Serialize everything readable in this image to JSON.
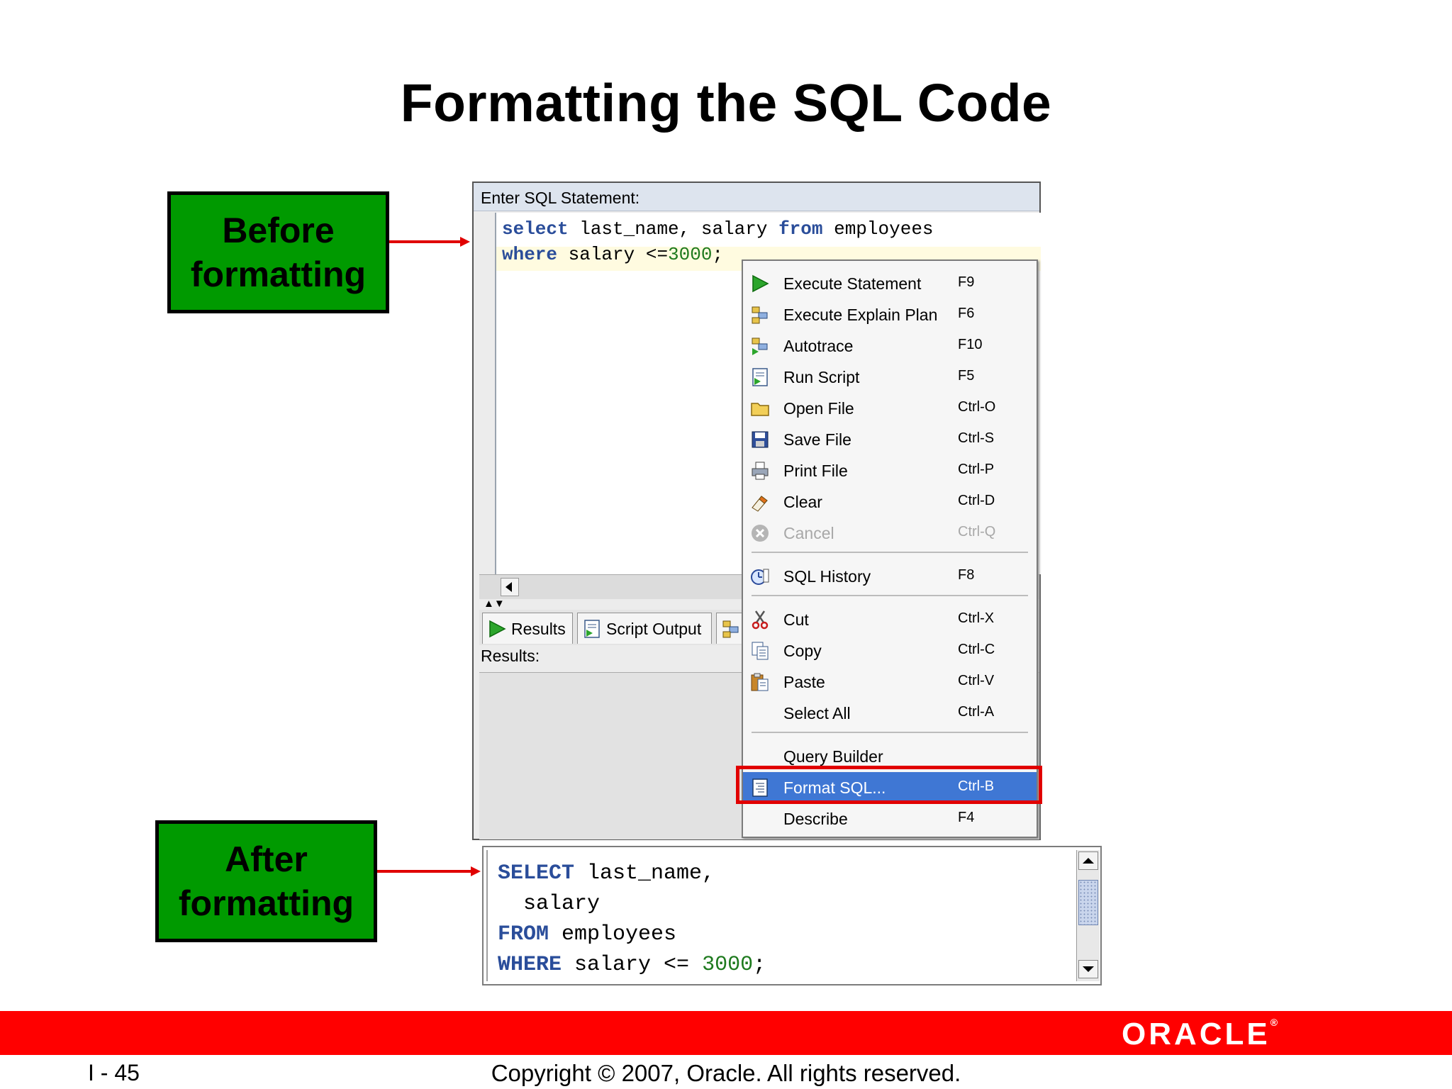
{
  "title": "Formatting the SQL Code",
  "callouts": {
    "before_line1": "Before",
    "before_line2": "formatting",
    "after_line1": "After",
    "after_line2": "formatting"
  },
  "sql_window": {
    "label": "Enter SQL Statement:",
    "code": {
      "line1_kw1": "select",
      "line1_mid": " last_name, salary ",
      "line1_kw2": "from",
      "line1_end": " employees",
      "line2_kw": "where",
      "line2_mid": " salary <=",
      "line2_num": "3000",
      "line2_end": ";"
    },
    "tabs": {
      "results": "Results",
      "script_output": "Script Output"
    },
    "results_label": "Results:"
  },
  "context_menu": {
    "items": [
      {
        "label": "Execute Statement",
        "shortcut": "F9",
        "icon": "play-icon"
      },
      {
        "label": "Execute Explain Plan",
        "shortcut": "F6",
        "icon": "explain-plan-icon"
      },
      {
        "label": "Autotrace",
        "shortcut": "F10",
        "icon": "autotrace-icon"
      },
      {
        "label": "Run Script",
        "shortcut": "F5",
        "icon": "run-script-icon"
      },
      {
        "label": "Open File",
        "shortcut": "Ctrl-O",
        "icon": "folder-icon"
      },
      {
        "label": "Save File",
        "shortcut": "Ctrl-S",
        "icon": "floppy-icon"
      },
      {
        "label": "Print File",
        "shortcut": "Ctrl-P",
        "icon": "printer-icon"
      },
      {
        "label": "Clear",
        "shortcut": "Ctrl-D",
        "icon": "eraser-icon"
      },
      {
        "label": "Cancel",
        "shortcut": "Ctrl-Q",
        "icon": "cancel-icon"
      },
      {
        "label": "SQL History",
        "shortcut": "F8",
        "icon": "history-icon"
      },
      {
        "label": "Cut",
        "shortcut": "Ctrl-X",
        "icon": "scissors-icon"
      },
      {
        "label": "Copy",
        "shortcut": "Ctrl-C",
        "icon": "copy-icon"
      },
      {
        "label": "Paste",
        "shortcut": "Ctrl-V",
        "icon": "paste-icon"
      },
      {
        "label": "Select All",
        "shortcut": "Ctrl-A",
        "icon": ""
      },
      {
        "label": "Query Builder",
        "shortcut": "",
        "icon": ""
      },
      {
        "label": "Format SQL...",
        "shortcut": "Ctrl-B",
        "icon": "format-sql-icon"
      },
      {
        "label": "Describe",
        "shortcut": "F4",
        "icon": ""
      }
    ]
  },
  "after_code": {
    "l1_kw": "SELECT",
    "l1_rest": " last_name,",
    "l2": "  salary",
    "l3_kw": "FROM",
    "l3_rest": " employees",
    "l4_kw": "WHERE",
    "l4_mid": " salary <= ",
    "l4_num": "3000",
    "l4_end": ";"
  },
  "footer": {
    "logo": "ORACLE",
    "page_number": "I - 45",
    "copyright": "Copyright © 2007, Oracle. All rights reserved."
  },
  "colors": {
    "callout_green": "#009a00",
    "keyword_blue": "#2a4d9a",
    "number_green": "#1e7a1e",
    "highlight_red": "#e10000",
    "selection_blue": "#3f77d4",
    "footer_red": "#ff0000"
  }
}
